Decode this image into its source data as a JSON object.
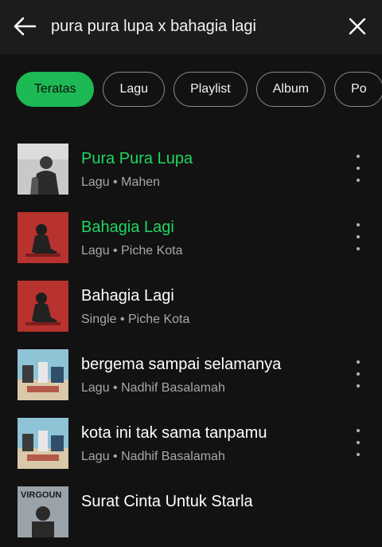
{
  "header": {
    "back_icon": "arrow-left-icon",
    "query": "pura pura lupa x bahagia lagi",
    "clear_icon": "close-icon"
  },
  "filters": [
    {
      "label": "Teratas",
      "active": true
    },
    {
      "label": "Lagu",
      "active": false
    },
    {
      "label": "Playlist",
      "active": false
    },
    {
      "label": "Album",
      "active": false
    },
    {
      "label": "Po",
      "active": false
    }
  ],
  "colors": {
    "accent": "#1db954",
    "title_green": "#1ed760",
    "background": "#121212",
    "secondary_text": "#a7a7a7"
  },
  "results": [
    {
      "title": "Pura Pura Lupa",
      "type": "Lagu",
      "artist": "Mahen",
      "highlighted": true,
      "cover": "grey-portrait"
    },
    {
      "title": "Bahagia Lagi",
      "type": "Lagu",
      "artist": "Piche Kota",
      "highlighted": true,
      "cover": "red-seated"
    },
    {
      "title": "Bahagia Lagi",
      "type": "Single",
      "artist": "Piche Kota",
      "highlighted": false,
      "cover": "red-seated"
    },
    {
      "title": "bergema sampai selamanya",
      "type": "Lagu",
      "artist": "Nadhif Basalamah",
      "highlighted": false,
      "cover": "blue-collage"
    },
    {
      "title": "kota ini tak sama tanpamu",
      "type": "Lagu",
      "artist": "Nadhif Basalamah",
      "highlighted": false,
      "cover": "blue-collage"
    },
    {
      "title": "Surat Cinta Untuk Starla",
      "type": "",
      "artist": "",
      "highlighted": false,
      "cover": "virgoun"
    }
  ],
  "separator": "•",
  "virgoun_text": "VIRGOUN"
}
